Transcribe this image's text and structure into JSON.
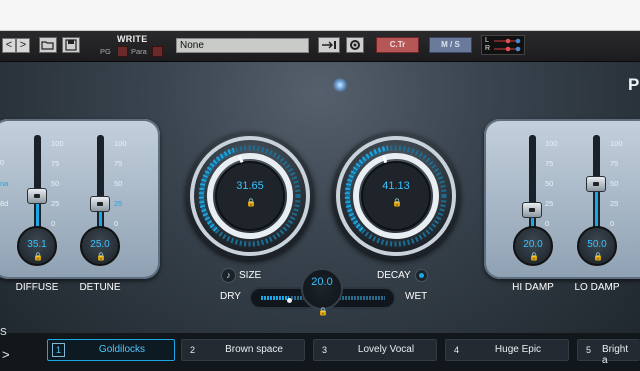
{
  "toolbar": {
    "back": "<",
    "forward": ">",
    "write": "WRITE",
    "pg": "PG",
    "para": "Para",
    "preset_value": "None",
    "ctr": "C.Tr",
    "ms": "M / S",
    "l": "L",
    "r": "R"
  },
  "plugin": {
    "brand_letter": "P",
    "left_scale": [
      "100",
      "75",
      "50",
      "25",
      "0"
    ],
    "left_edge_scale": [
      "0",
      "na",
      "8d"
    ],
    "right_scale": [
      "100",
      "75",
      "50",
      "25",
      "0"
    ],
    "faders": [
      {
        "label": "DIFFUSE",
        "value": "35.1",
        "percent": 35.1
      },
      {
        "label": "DETUNE",
        "value": "25.0",
        "percent": 25
      },
      {
        "label": "HI DAMP",
        "value": "20.0",
        "percent": 20
      },
      {
        "label": "LO DAMP",
        "value": "50.0",
        "percent": 50
      }
    ],
    "size": {
      "label": "SIZE",
      "value": "31.65"
    },
    "decay": {
      "label": "DECAY",
      "value": "41.13"
    },
    "mix": {
      "value": "20.0",
      "dry": "DRY",
      "wet": "WET",
      "percent": 20
    }
  },
  "presets": [
    {
      "num": "1",
      "name": "Goldilocks",
      "selected": true
    },
    {
      "num": "2",
      "name": "Brown space",
      "selected": false
    },
    {
      "num": "3",
      "name": "Lovely Vocal",
      "selected": false
    },
    {
      "num": "4",
      "name": "Huge Epic",
      "selected": false
    },
    {
      "num": "5",
      "name": "Bright a",
      "selected": false
    }
  ],
  "side": {
    "s": "S",
    "arrow": ">"
  },
  "colors": {
    "accent": "#1aa7e6",
    "ctr": "#b55757",
    "ms": "#6a7a9a"
  }
}
